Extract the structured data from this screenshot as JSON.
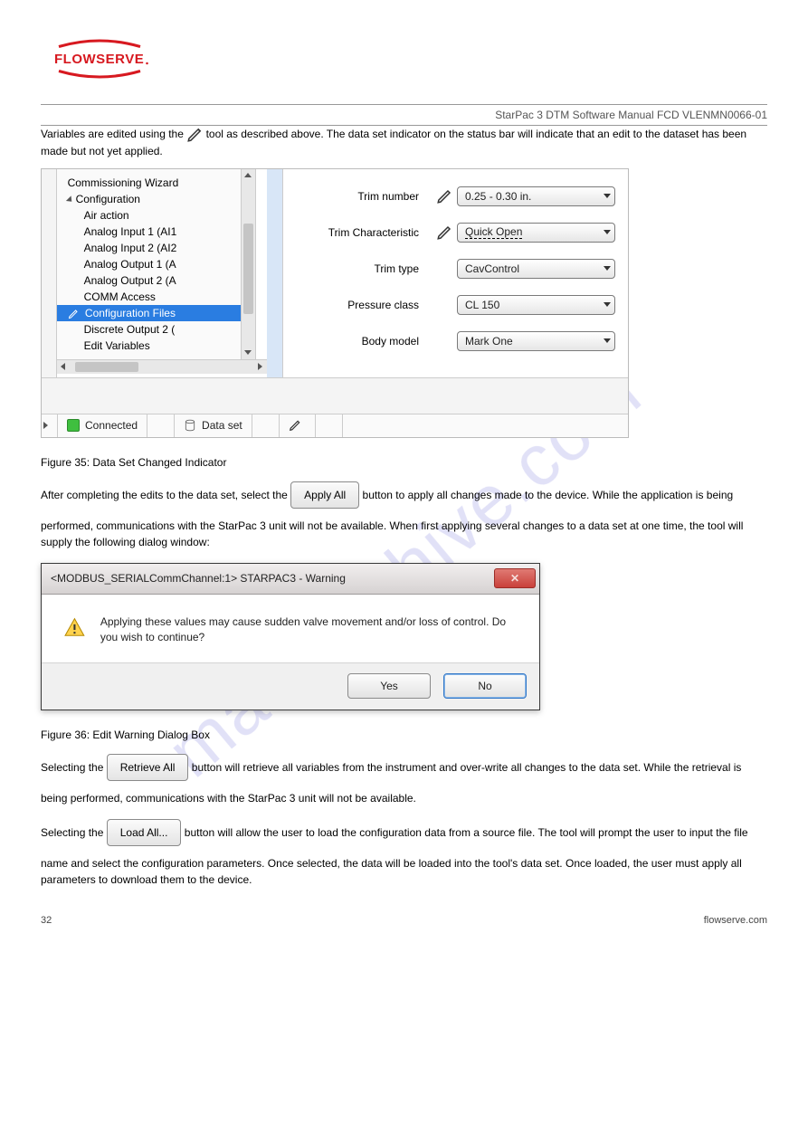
{
  "logo_text": "FLOWSERVE",
  "header_right": "StarPac 3 DTM Software Manual FCD VLENMN0066-01",
  "intro": {
    "line1_a": "Variables are edited using the ",
    "line1_b": " tool as described above. The data set indicator on the status bar will indicate",
    "line2": "that an edit to the dataset has been made but not yet applied."
  },
  "tree": {
    "items": [
      "Commissioning Wizard",
      "Configuration",
      "Air action",
      "Analog Input 1 (AI1",
      "Analog Input 2 (AI2",
      "Analog Output 1 (A",
      "Analog Output 2 (A",
      "COMM Access",
      "Configuration Files",
      "Discrete Output 2 (",
      "Edit Variables"
    ],
    "selected_index": 8
  },
  "form": {
    "rows": [
      {
        "label": "Trim number",
        "has_pencil": true,
        "value": "0.25 - 0.30 in.",
        "dashed": false
      },
      {
        "label": "Trim Characteristic",
        "has_pencil": true,
        "value": "Quick Open",
        "dashed": true
      },
      {
        "label": "Trim type",
        "has_pencil": false,
        "value": "CavControl",
        "dashed": false
      },
      {
        "label": "Pressure class",
        "has_pencil": false,
        "value": "CL 150",
        "dashed": false
      },
      {
        "label": "Body model",
        "has_pencil": false,
        "value": "Mark One",
        "dashed": false
      }
    ]
  },
  "status": {
    "connected": "Connected",
    "dataset": "Data set"
  },
  "fig35_caption": "Figure 35: Data Set Changed Indicator",
  "apply_section": {
    "p1_a": "After completing the edits to the data set, select the ",
    "btn": "Apply All",
    "p1_b": " button to apply all changes made to the device. While",
    "p2": "the application is being performed, communications with the StarPac 3 unit will not be available. When first applying several changes to a data set at one time, the tool will supply the following dialog window:"
  },
  "dialog": {
    "title": "<MODBUS_SERIALCommChannel:1> STARPAC3 - Warning",
    "text": "Applying these values may cause sudden valve movement and/or loss of control.  Do you wish to continue?",
    "yes": "Yes",
    "no": "No"
  },
  "fig36_caption": "Figure 36: Edit Warning Dialog Box",
  "retrieve_section": {
    "p1_a": "Selecting the ",
    "btn": "Retrieve All",
    "p1_b": " button will retrieve all variables from the instrument and over-write all changes to the data",
    "p2": "set.  While the retrieval is being performed, communications with the StarPac 3 unit will not be available."
  },
  "load_section": {
    "p1_a": "Selecting the ",
    "btn": "Load All...",
    "p1_b": " button will allow the user to load the configuration data from a source file.  The tool will",
    "p2": "prompt the user to input the file name and select the configuration parameters.  Once selected, the data will be loaded into the tool's data set.  Once loaded, the user must apply all parameters to download them to the device."
  },
  "footer": {
    "page": "32",
    "site": "flowserve.com"
  }
}
